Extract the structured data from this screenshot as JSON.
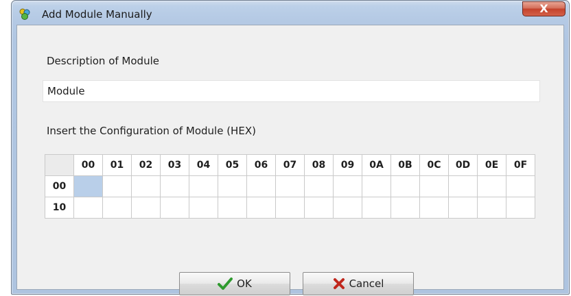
{
  "window": {
    "title": "Add Module Manually",
    "close_glyph": "X",
    "icon": "app-module-icon"
  },
  "description": {
    "label": "Description of Module",
    "value": "Module"
  },
  "config": {
    "label": "Insert the Configuration of Module (HEX)",
    "columns": [
      "00",
      "01",
      "02",
      "03",
      "04",
      "05",
      "06",
      "07",
      "08",
      "09",
      "0A",
      "0B",
      "0C",
      "0D",
      "0E",
      "0F"
    ],
    "rows": [
      "00",
      "10"
    ],
    "selected_cell": {
      "row": "00",
      "col": "00"
    }
  },
  "buttons": {
    "ok_label": "OK",
    "ok_icon": "checkmark-icon",
    "cancel_label": "Cancel",
    "cancel_icon": "x-mark-icon"
  },
  "colors": {
    "titlebar": "#b4c9e4",
    "close_button": "#c4432c",
    "selected_cell": "#b9cfe9",
    "ok_check": "#2e9a2e",
    "cancel_x": "#c0271d"
  }
}
